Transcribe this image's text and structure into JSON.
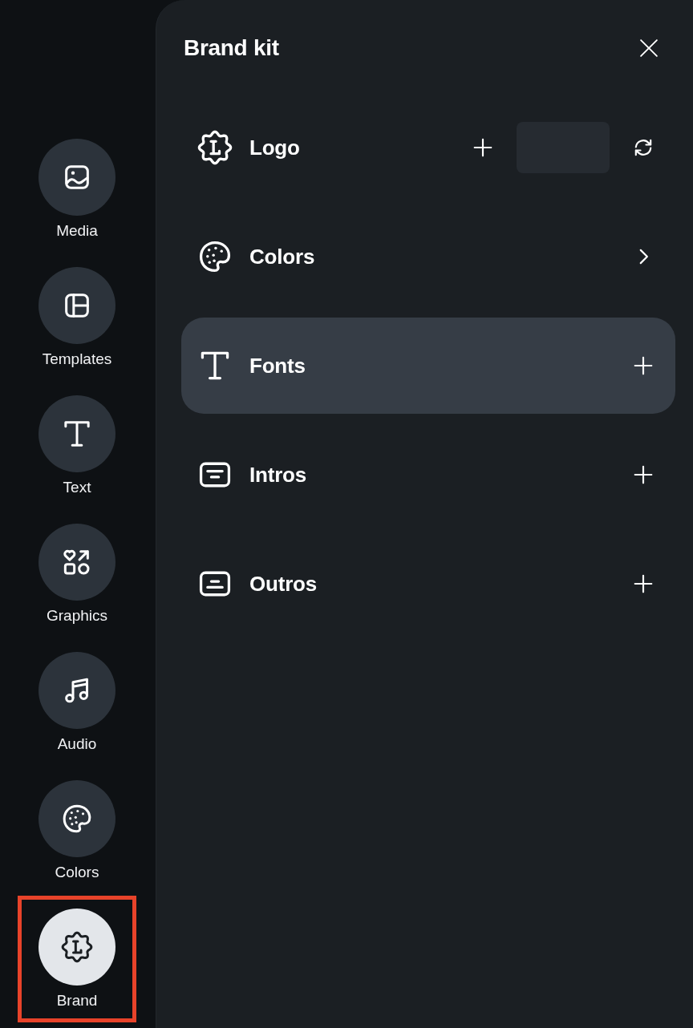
{
  "sidebar": {
    "items": [
      {
        "label": "Media",
        "kind": "media",
        "selected": false,
        "highlighted": false
      },
      {
        "label": "Templates",
        "kind": "templates",
        "selected": false,
        "highlighted": false
      },
      {
        "label": "Text",
        "kind": "text",
        "selected": false,
        "highlighted": false
      },
      {
        "label": "Graphics",
        "kind": "graphics",
        "selected": false,
        "highlighted": false
      },
      {
        "label": "Audio",
        "kind": "audio",
        "selected": false,
        "highlighted": false
      },
      {
        "label": "Colors",
        "kind": "colors",
        "selected": false,
        "highlighted": false
      },
      {
        "label": "Brand",
        "kind": "brand",
        "selected": true,
        "highlighted": true
      }
    ]
  },
  "panel": {
    "title": "Brand kit",
    "rows": [
      {
        "label": "Logo",
        "kind": "logo",
        "selected": false
      },
      {
        "label": "Colors",
        "kind": "colors",
        "selected": false
      },
      {
        "label": "Fonts",
        "kind": "fonts",
        "selected": true
      },
      {
        "label": "Intros",
        "kind": "intros",
        "selected": false
      },
      {
        "label": "Outros",
        "kind": "outros",
        "selected": false
      }
    ]
  }
}
